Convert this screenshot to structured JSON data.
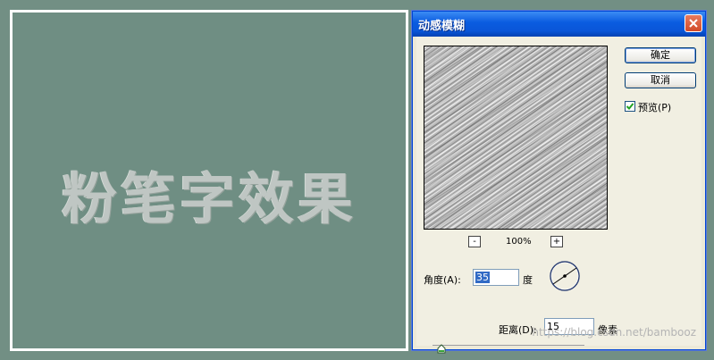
{
  "canvas": {
    "chalk_text": "粉笔字效果"
  },
  "dialog": {
    "title": "动感模糊",
    "ok_label": "确定",
    "cancel_label": "取消",
    "preview_checkbox": {
      "label": "预览(P)",
      "checked": true
    },
    "zoom": {
      "minus": "-",
      "plus": "+",
      "level": "100%"
    },
    "angle": {
      "label": "角度(A):",
      "value": "35",
      "unit": "度"
    },
    "distance": {
      "label": "距离(D):",
      "value": "15",
      "unit": "像素"
    },
    "slider_fraction": 0.03
  },
  "watermark": "https://blog.csdn.net/bambooz",
  "colors": {
    "titlebar": "#0a5ce0",
    "canvas": "#6f8e83",
    "selection": "#316ac5"
  }
}
